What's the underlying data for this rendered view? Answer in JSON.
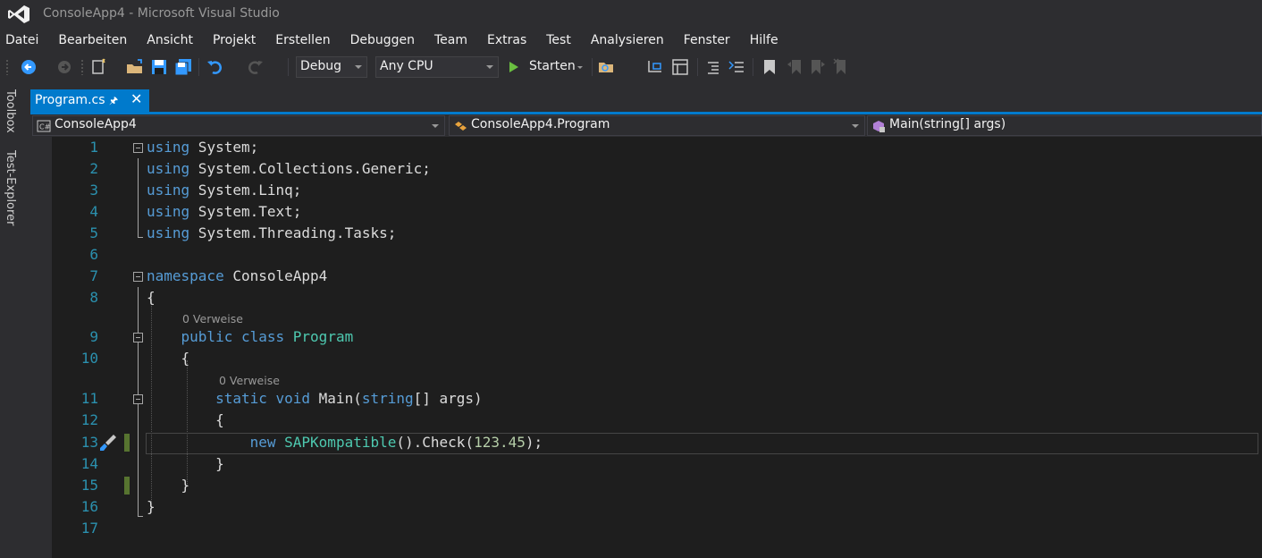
{
  "window": {
    "title": "ConsoleApp4 - Microsoft Visual Studio"
  },
  "menu": [
    "Datei",
    "Bearbeiten",
    "Ansicht",
    "Projekt",
    "Erstellen",
    "Debuggen",
    "Team",
    "Extras",
    "Test",
    "Analysieren",
    "Fenster",
    "Hilfe"
  ],
  "toolbar": {
    "configuration": "Debug",
    "platform": "Any CPU",
    "start_label": "Starten",
    "icons": [
      "back-icon",
      "forward-icon",
      "new-project-icon",
      "open-folder-icon",
      "save-icon",
      "save-all-icon",
      "undo-icon",
      "redo-icon",
      "start-icon",
      "find-in-files-icon",
      "bookmark-icon"
    ]
  },
  "sidebar": {
    "toolbox": "Toolbox",
    "test_explorer": "Test-Explorer"
  },
  "tabs": [
    {
      "label": "Program.cs",
      "active": true
    }
  ],
  "navbar": {
    "project": "ConsoleApp4",
    "type": "ConsoleApp4.Program",
    "member": "Main(string[] args)"
  },
  "code": {
    "line_numbers": [
      "1",
      "2",
      "3",
      "4",
      "5",
      "6",
      "7",
      "8",
      "9",
      "10",
      "11",
      "12",
      "13",
      "14",
      "15",
      "16",
      "17"
    ],
    "lines": [
      [
        [
          "kw",
          "using"
        ],
        [
          "tx",
          " System;"
        ]
      ],
      [
        [
          "kw",
          "using"
        ],
        [
          "tx",
          " System.Collections.Generic;"
        ]
      ],
      [
        [
          "kw",
          "using"
        ],
        [
          "tx",
          " System.Linq;"
        ]
      ],
      [
        [
          "kw",
          "using"
        ],
        [
          "tx",
          " System.Text;"
        ]
      ],
      [
        [
          "kw",
          "using"
        ],
        [
          "tx",
          " System.Threading.Tasks;"
        ]
      ],
      [],
      [
        [
          "kw",
          "namespace"
        ],
        [
          "tx",
          " ConsoleApp4"
        ]
      ],
      [
        [
          "tx",
          "{"
        ]
      ],
      [
        [
          "tx",
          "    "
        ],
        [
          "kw",
          "public"
        ],
        [
          "tx",
          " "
        ],
        [
          "kw",
          "class"
        ],
        [
          "tx",
          " "
        ],
        [
          "ty",
          "Program"
        ]
      ],
      [
        [
          "tx",
          "    {"
        ]
      ],
      [
        [
          "tx",
          "        "
        ],
        [
          "kw",
          "static"
        ],
        [
          "tx",
          " "
        ],
        [
          "kw",
          "void"
        ],
        [
          "tx",
          " Main("
        ],
        [
          "kw",
          "string"
        ],
        [
          "tx",
          "[] args)"
        ]
      ],
      [
        [
          "tx",
          "        {"
        ]
      ],
      [
        [
          "tx",
          "            "
        ],
        [
          "kw",
          "new"
        ],
        [
          "tx",
          " "
        ],
        [
          "ty",
          "SAPKompatible"
        ],
        [
          "tx",
          "().Check("
        ],
        [
          "num",
          "123.45"
        ],
        [
          "tx",
          ");"
        ]
      ],
      [
        [
          "tx",
          "        }"
        ]
      ],
      [
        [
          "tx",
          "    }"
        ]
      ],
      [
        [
          "tx",
          "}"
        ]
      ],
      []
    ],
    "references_label": "0 Verweise"
  },
  "colors": {
    "accent": "#007acc",
    "keyword": "#569cd6",
    "type": "#4ec9b0",
    "number": "#b5cea8",
    "line_number": "#2b91af"
  }
}
